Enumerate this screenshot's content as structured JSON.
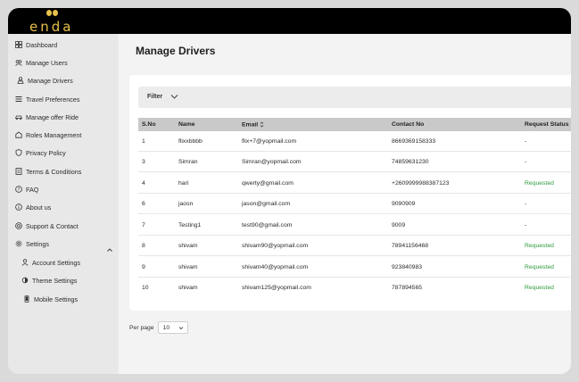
{
  "app": {
    "logo_text": "enda"
  },
  "sidebar": {
    "items": [
      {
        "label": "Dashboard",
        "icon": "grid-icon"
      },
      {
        "label": "Manage Users",
        "icon": "users-icon"
      },
      {
        "label": "Manage Drivers",
        "icon": "driver-icon"
      },
      {
        "label": "Travel Preferences",
        "icon": "list-icon"
      },
      {
        "label": "Manage offer Ride",
        "icon": "car-icon"
      },
      {
        "label": "Roles Management",
        "icon": "roles-icon"
      },
      {
        "label": "Privacy Policy",
        "icon": "shield-icon"
      },
      {
        "label": "Terms & Conditions",
        "icon": "document-icon"
      },
      {
        "label": "FAQ",
        "icon": "question-icon"
      },
      {
        "label": "About us",
        "icon": "info-icon"
      },
      {
        "label": "Support & Contact",
        "icon": "support-icon"
      },
      {
        "label": "Settings",
        "icon": "gear-icon"
      }
    ],
    "sub_items": [
      {
        "label": "Account Settings",
        "icon": "account-icon"
      },
      {
        "label": "Theme Settings",
        "icon": "theme-icon"
      },
      {
        "label": "Mobile Settings",
        "icon": "mobile-icon"
      }
    ]
  },
  "main": {
    "title": "Manage Drivers",
    "filter_label": "Filter",
    "table": {
      "headers": [
        "S.No",
        "Name",
        "Email",
        "Contact No",
        "Request Status"
      ],
      "rows": [
        {
          "sno": "1",
          "name": "flixxbbbb",
          "email": "flix+7@yopmail.com",
          "contact": "8669369158333",
          "status": "-"
        },
        {
          "sno": "3",
          "name": "Simran",
          "email": "Simran@yopmail.com",
          "contact": "74859631230",
          "status": "-"
        },
        {
          "sno": "4",
          "name": "hari",
          "email": "qwerty@gmail.com",
          "contact": "+2609999988387123",
          "status": "Requested"
        },
        {
          "sno": "6",
          "name": "jaosn",
          "email": "jason@gmail.com",
          "contact": "9090909",
          "status": "-"
        },
        {
          "sno": "7",
          "name": "Testing1",
          "email": "test90@gmail.com",
          "contact": "9009",
          "status": "-"
        },
        {
          "sno": "8",
          "name": "shivam",
          "email": "shivam90@yopmail.com",
          "contact": "78941156468",
          "status": "Requested"
        },
        {
          "sno": "9",
          "name": "shivam",
          "email": "shivam40@yopmail.com",
          "contact": "923840983",
          "status": "Requested"
        },
        {
          "sno": "10",
          "name": "shivam",
          "email": "shivam125@yopmail.com",
          "contact": "787894565",
          "status": "Requested"
        }
      ]
    },
    "pagination": {
      "per_page_label": "Per page",
      "per_page_value": "10"
    }
  },
  "colors": {
    "accent": "#e8c14a",
    "requested": "#2e9a3e",
    "topbar": "#000000"
  }
}
